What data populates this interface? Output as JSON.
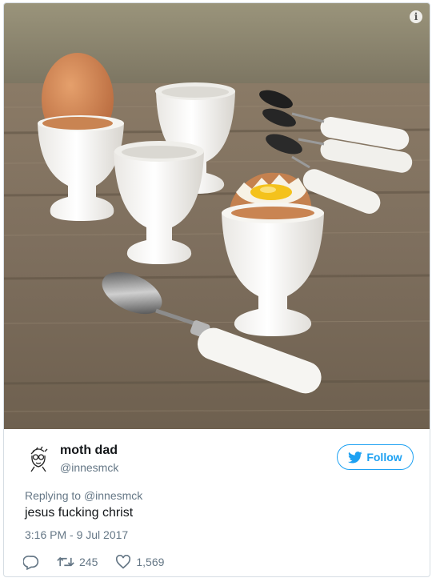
{
  "author": {
    "name": "moth dad",
    "handle": "@innesmck"
  },
  "follow_label": "Follow",
  "replying": {
    "prefix": "Replying to ",
    "mention": "@innesmck"
  },
  "tweet_text": "jesus fucking christ",
  "timestamp": "3:16 PM - 9 Jul 2017",
  "stats": {
    "retweets": "245",
    "likes": "1,569"
  },
  "info_glyph": "i",
  "colors": {
    "twitter_blue": "#1da1f2",
    "secondary_text": "#657786",
    "primary_text": "#14171a"
  },
  "icons": {
    "reply": "reply-icon",
    "retweet": "retweet-icon",
    "like": "heart-icon",
    "follow": "twitter-bird-icon",
    "info": "info-icon"
  }
}
